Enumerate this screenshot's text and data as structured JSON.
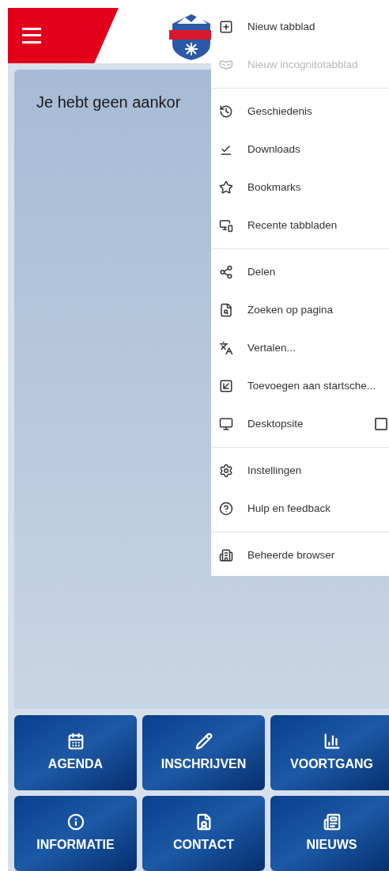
{
  "message": "Je hebt geen aankor",
  "browser_menu": {
    "items": [
      {
        "kind": "item",
        "label": "Nieuw tabblad",
        "disabled": false
      },
      {
        "kind": "item",
        "label": "Nieuw incognitotabblad",
        "disabled": true
      },
      {
        "kind": "divider"
      },
      {
        "kind": "item",
        "label": "Geschiedenis",
        "disabled": false
      },
      {
        "kind": "item",
        "label": "Downloads",
        "disabled": false
      },
      {
        "kind": "item",
        "label": "Bookmarks",
        "disabled": false
      },
      {
        "kind": "item",
        "label": "Recente tabbladen",
        "disabled": false
      },
      {
        "kind": "divider"
      },
      {
        "kind": "item",
        "label": "Delen",
        "disabled": false
      },
      {
        "kind": "item",
        "label": "Zoeken op pagina",
        "disabled": false
      },
      {
        "kind": "item",
        "label": "Vertalen...",
        "disabled": false
      },
      {
        "kind": "item",
        "label": "Toevoegen aan startsche...",
        "disabled": false
      },
      {
        "kind": "checkbox",
        "label": "Desktopsite",
        "checked": false
      },
      {
        "kind": "divider"
      },
      {
        "kind": "item",
        "label": "Instellingen",
        "disabled": false
      },
      {
        "kind": "item",
        "label": "Hulp en feedback",
        "disabled": false
      },
      {
        "kind": "divider"
      },
      {
        "kind": "item",
        "label": "Beheerde browser",
        "disabled": false
      }
    ]
  },
  "tiles": [
    {
      "label": "AGENDA"
    },
    {
      "label": "INSCHRIJVEN"
    },
    {
      "label": "VOORTGANG"
    },
    {
      "label": "INFORMATIE"
    },
    {
      "label": "CONTACT"
    },
    {
      "label": "NIEUWS"
    }
  ]
}
